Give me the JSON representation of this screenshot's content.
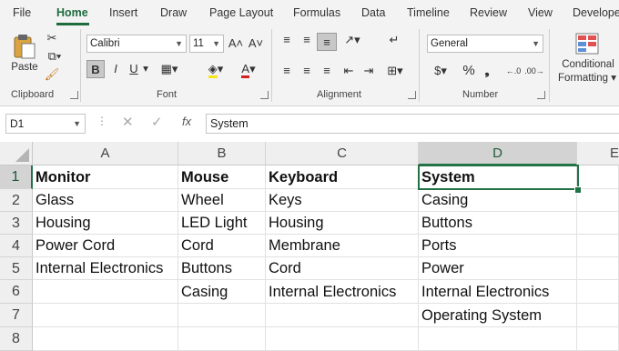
{
  "tabs": [
    "File",
    "Home",
    "Insert",
    "Draw",
    "Page Layout",
    "Formulas",
    "Data",
    "Timeline",
    "Review",
    "View",
    "Develope"
  ],
  "ribbon": {
    "clipboard": {
      "paste": "Paste",
      "label": "Clipboard"
    },
    "font": {
      "name": "Calibri",
      "size": "11",
      "grow": "A˄",
      "shrink": "A˅",
      "bold": "B",
      "italic": "I",
      "underline": "U",
      "label": "Font"
    },
    "alignment": {
      "label": "Alignment"
    },
    "number": {
      "format": "General",
      "currency": "$",
      "percent": "%",
      "comma": "ⱺ",
      "inc": "←.0",
      "dec": ".00→",
      "label": "Number"
    },
    "styles": {
      "conditional": "Conditional",
      "formatting": "Formatting"
    }
  },
  "formula_bar": {
    "name_box": "D1",
    "fx": "fx",
    "value": "System"
  },
  "grid": {
    "columns": [
      "A",
      "B",
      "C",
      "D",
      "E"
    ],
    "rows": [
      "1",
      "2",
      "3",
      "4",
      "5",
      "6",
      "7",
      "8"
    ],
    "cells": [
      [
        "Monitor",
        "Mouse",
        "Keyboard",
        "System"
      ],
      [
        "Glass",
        "Wheel",
        "Keys",
        "Casing"
      ],
      [
        "Housing",
        "LED Light",
        "Housing",
        "Buttons"
      ],
      [
        "Power Cord",
        "Cord",
        "Membrane",
        "Ports"
      ],
      [
        "Internal Electronics",
        "Buttons",
        "Cord",
        "Power"
      ],
      [
        "",
        "Casing",
        "Internal Electronics",
        "Internal Electronics"
      ],
      [
        "",
        "",
        "",
        "Operating System"
      ],
      [
        "",
        "",
        "",
        ""
      ]
    ]
  }
}
